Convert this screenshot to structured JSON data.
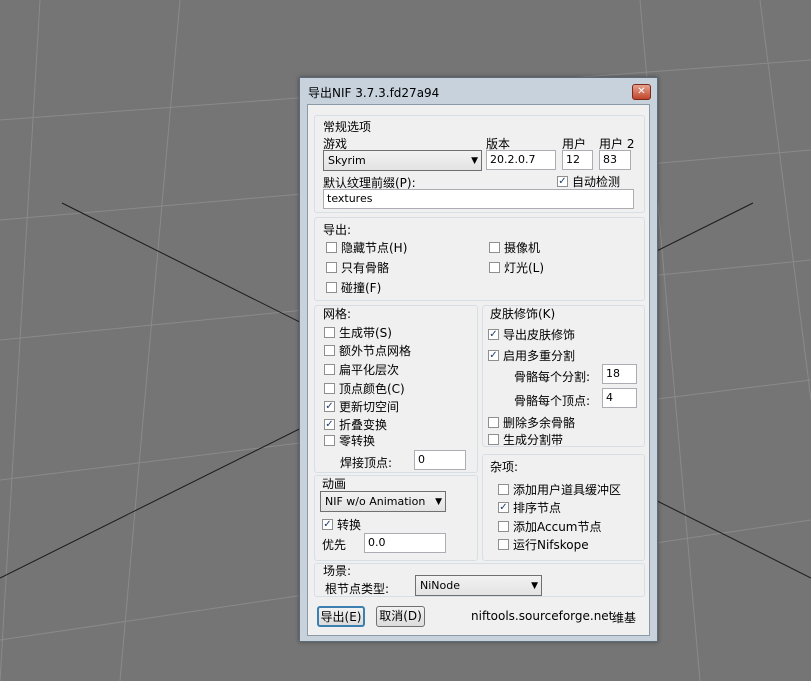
{
  "dialog": {
    "title": "导出NIF 3.7.3.fd27a94",
    "close": "✕"
  },
  "general": {
    "legend": "常规选项",
    "game_label": "游戏",
    "game_value": "Skyrim",
    "version_label": "版本",
    "version_value": "20.2.0.7",
    "user_label": "用户",
    "user_value": "12",
    "user2_label": "用户 2",
    "user2_value": "83",
    "prefix_label": "默认纹理前缀(P):",
    "prefix_value": "textures",
    "autodetect_label": "自动检测"
  },
  "export": {
    "legend": "导出:",
    "hidden_nodes": "隐藏节点(H)",
    "camera": "摄像机",
    "bones_only": "只有骨骼",
    "lights": "灯光(L)",
    "collision": "碰撞(F)"
  },
  "mesh": {
    "legend": "网格:",
    "gen_strips": "生成带(S)",
    "extra_nodes": "额外节点网格",
    "flatten": "扁平化层次",
    "vertex_colors": "顶点颜色(C)",
    "update_tangents": "更新切空间",
    "collapse": "折叠变换",
    "zero_transforms": "零转换",
    "weld_label": "焊接顶点:",
    "weld_value": "0"
  },
  "skin": {
    "legend": "皮肤修饰(K)",
    "export_skin": "导出皮肤修饰",
    "enable_multi": "启用多重分割",
    "bones_per_part_label": "骨骼每个分割:",
    "bones_per_part_value": "18",
    "bones_per_vertex_label": "骨骼每个顶点:",
    "bones_per_vertex_value": "4",
    "remove_bones": "删除多余骨骼",
    "gen_part_strips": "生成分割带"
  },
  "anim": {
    "legend": "动画",
    "mode": "NIF w/o Animation",
    "transform": "转换",
    "priority_label": "优先",
    "priority_value": "0.0"
  },
  "misc": {
    "legend": "杂项:",
    "user_prop": "添加用户道具缓冲区",
    "sort_nodes": "排序节点",
    "add_accum": "添加Accum节点",
    "run_nifskope": "运行Nifskope"
  },
  "scene": {
    "legend": "场景:",
    "root_label": "根节点类型:",
    "root_value": "NiNode"
  },
  "footer": {
    "export_btn": "导出(E)",
    "cancel_btn": "取消(D)",
    "link": "niftools.sourceforge.net",
    "wiki": "维基"
  },
  "checks": {
    "hidden_nodes": false,
    "camera": false,
    "bones_only": false,
    "lights": false,
    "collision": false,
    "gen_strips": false,
    "extra_nodes": false,
    "flatten": false,
    "vertex_colors": false,
    "update_tangents": true,
    "collapse": true,
    "zero_transforms": false,
    "export_skin": true,
    "enable_multi": true,
    "remove_bones": false,
    "gen_part_strips": false,
    "transform": true,
    "user_prop": false,
    "sort_nodes": true,
    "add_accum": false,
    "run_nifskope": false,
    "autodetect": true
  },
  "colors": {
    "background": "#757575",
    "grid": "#8a8a8a",
    "frame": "#c7d2dd",
    "client": "#f0f0f0"
  }
}
